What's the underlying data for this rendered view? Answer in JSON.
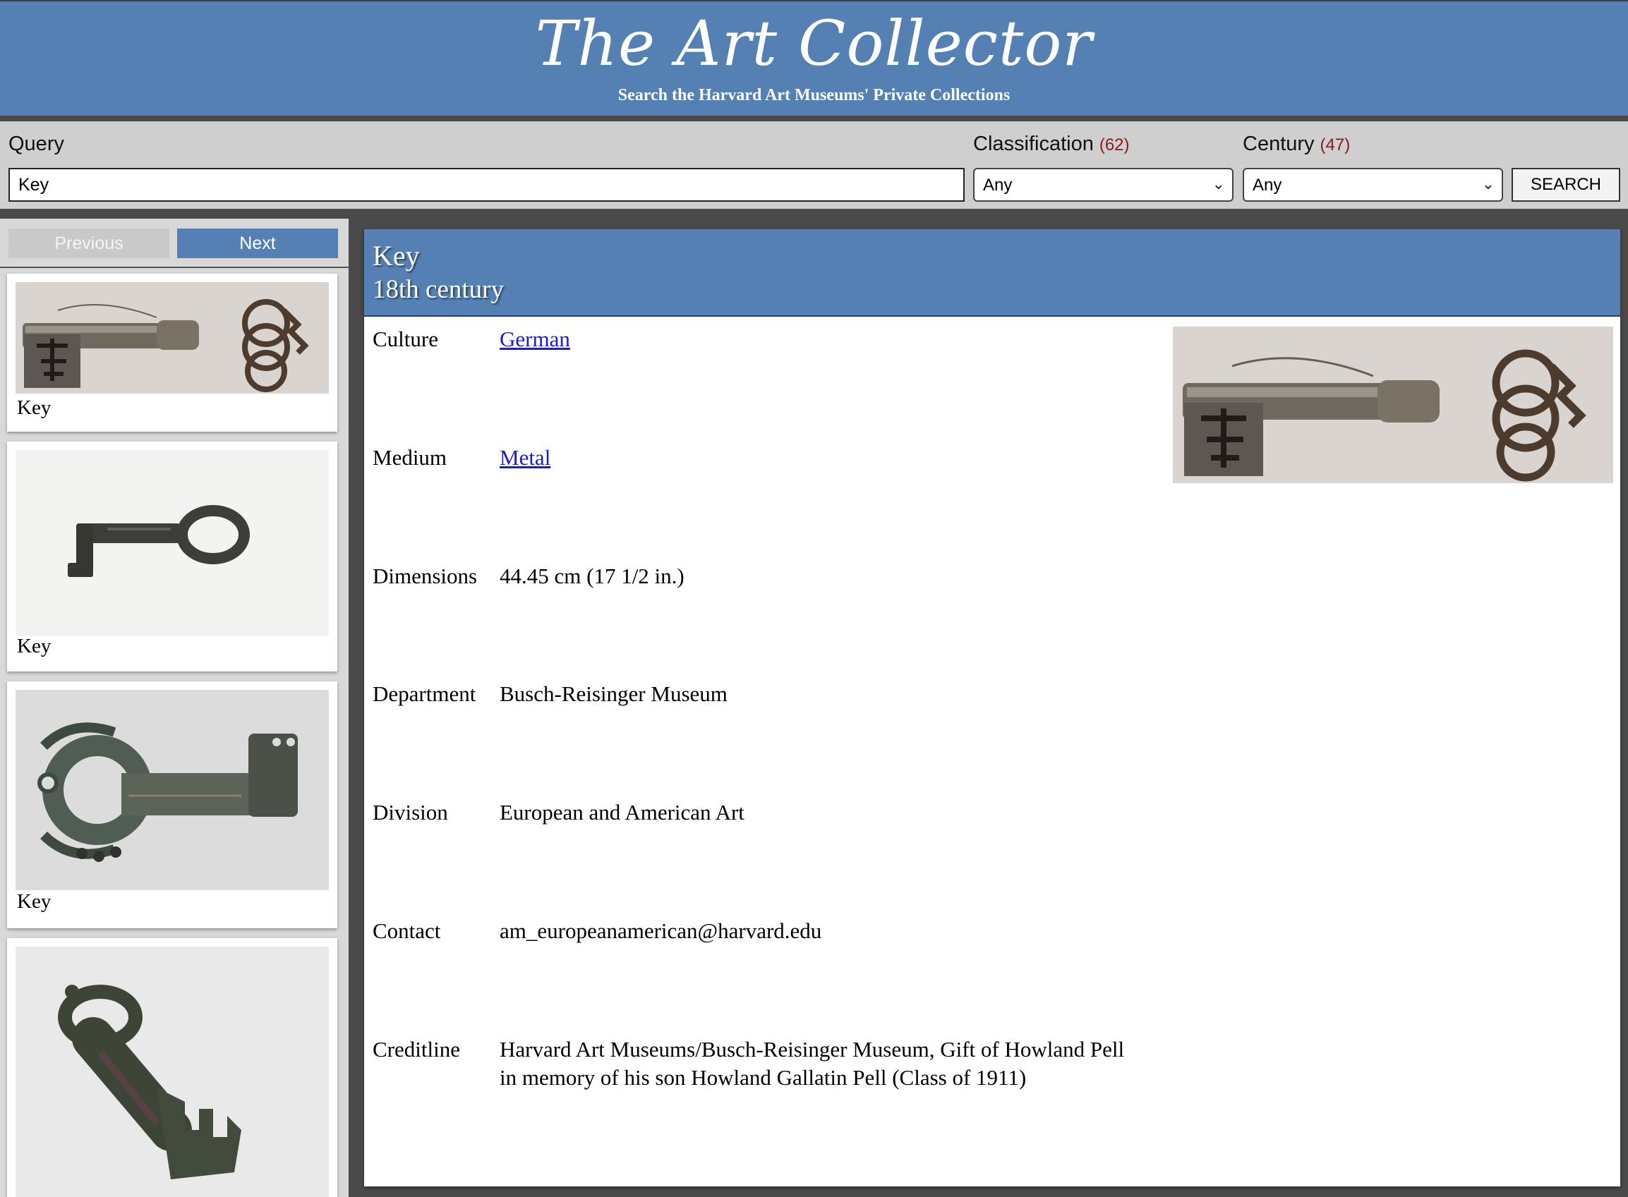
{
  "header": {
    "title": "The Art Collector",
    "tagline": "Search the Harvard Art Museums' Private Collections"
  },
  "search": {
    "query_label": "Query",
    "query_value": "Key",
    "classification_label": "Classification",
    "classification_count": "(62)",
    "classification_value": "Any",
    "century_label": "Century",
    "century_count": "(47)",
    "century_value": "Any",
    "search_button": "SEARCH"
  },
  "sidebar": {
    "previous_label": "Previous",
    "next_label": "Next",
    "results": [
      {
        "title": "Key",
        "image": "ornate-iron-key-with-ring-bow"
      },
      {
        "title": "Key",
        "image": "small-dark-iron-key"
      },
      {
        "title": "Key",
        "image": "green-bronze-key-with-ring"
      },
      {
        "title": "",
        "image": "bronze-ring-key"
      }
    ]
  },
  "detail": {
    "title": "Key",
    "subtitle": "18th century",
    "image": "ornate-iron-key-with-ring-bow",
    "facts": [
      {
        "label": "Culture",
        "value": "German",
        "link": true
      },
      {
        "label": "Medium",
        "value": "Metal",
        "link": true
      },
      {
        "label": "Dimensions",
        "value": "44.45 cm (17 1/2 in.)",
        "link": false
      },
      {
        "label": "Department",
        "value": "Busch-Reisinger Museum",
        "link": false
      },
      {
        "label": "Division",
        "value": "European and American Art",
        "link": false
      },
      {
        "label": "Contact",
        "value": "am_europeanamerican@harvard.edu",
        "link": false
      },
      {
        "label": "Creditline",
        "value_line1": "Harvard Art Museums/Busch-Reisinger Museum, Gift of Howland Pell",
        "value_line2": "in memory of his son Howland Gallatin Pell (Class of 1911)",
        "link": false
      }
    ]
  },
  "colors": {
    "brand_blue": "#5580b3",
    "link_blue": "#1a1adf",
    "count_red": "#8b1a1a"
  }
}
